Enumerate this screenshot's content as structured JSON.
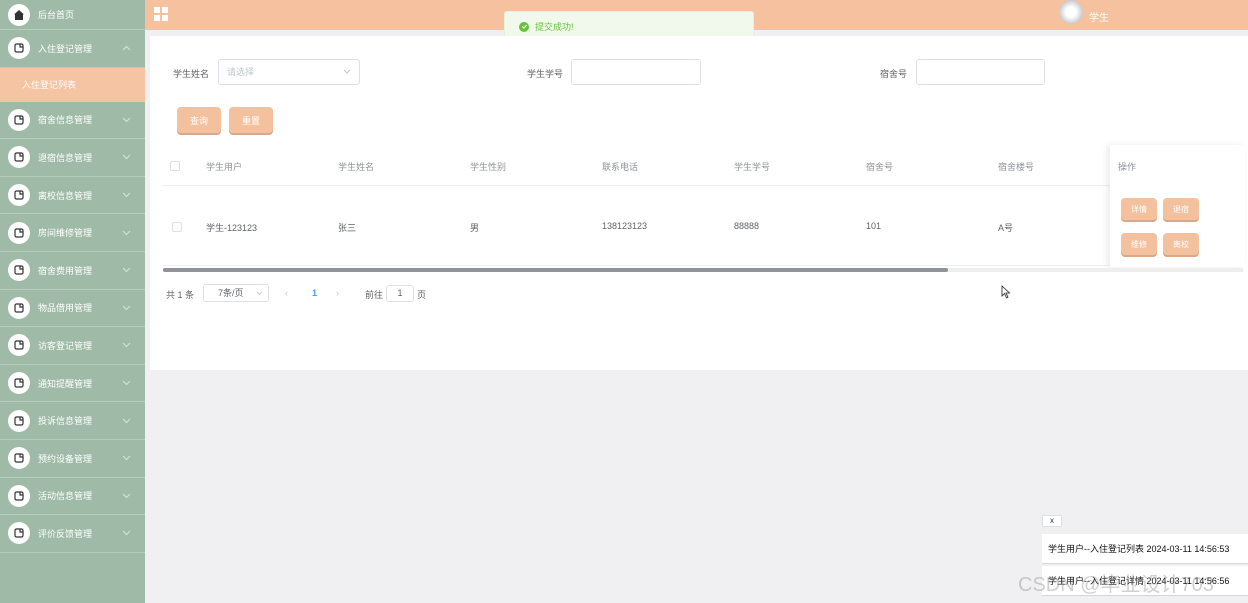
{
  "sidebar": {
    "home": "后台首页",
    "items": [
      {
        "label": "入住登记管理",
        "expanded": true
      },
      {
        "label": "入住登记列表",
        "sub": true
      },
      {
        "label": "宿舍信息管理"
      },
      {
        "label": "退宿信息管理"
      },
      {
        "label": "离校信息管理"
      },
      {
        "label": "房间维修管理"
      },
      {
        "label": "宿舍费用管理"
      },
      {
        "label": "物品借用管理"
      },
      {
        "label": "访客登记管理"
      },
      {
        "label": "通知提醒管理"
      },
      {
        "label": "投诉信息管理"
      },
      {
        "label": "预约设备管理"
      },
      {
        "label": "活动信息管理"
      },
      {
        "label": "评价反馈管理"
      }
    ]
  },
  "header": {
    "title": "",
    "user": "学生"
  },
  "toast": {
    "text": "提交成功!",
    "color": "#67c23a"
  },
  "form": {
    "name_label": "学生姓名",
    "name_placeholder": "请选择",
    "number_label": "学生学号",
    "dorm_label": "宿舍号",
    "search_label": "查询",
    "reset_label": "重置"
  },
  "table": {
    "headers": [
      "学生用户",
      "学生姓名",
      "学生性别",
      "联系电话",
      "学生学号",
      "宿舍号",
      "宿舍楼号",
      "操作"
    ],
    "rows": [
      {
        "user": "学生-123123",
        "name": "张三",
        "gender": "男",
        "phone": "138123123",
        "number": "88888",
        "dorm": "101",
        "building": "A号"
      }
    ],
    "ops": [
      "详情",
      "退宿",
      "维修",
      "离校"
    ]
  },
  "pagination": {
    "total": "共 1 条",
    "page_size": "7条/页",
    "current": "1",
    "goto": "前往",
    "goto_value": "1",
    "page_unit": "页"
  },
  "logs": {
    "close": "x",
    "lines": [
      "学生用户--入住登记列表 2024-03-11 14:56:53",
      "学生用户--入住登记详情 2024-03-11 14:56:56"
    ]
  },
  "watermark": "CSDN @毕业设计703",
  "colors": {
    "sidebar": "#9fbba7",
    "accent": "#f4c19f",
    "header": "#f5c19e"
  }
}
